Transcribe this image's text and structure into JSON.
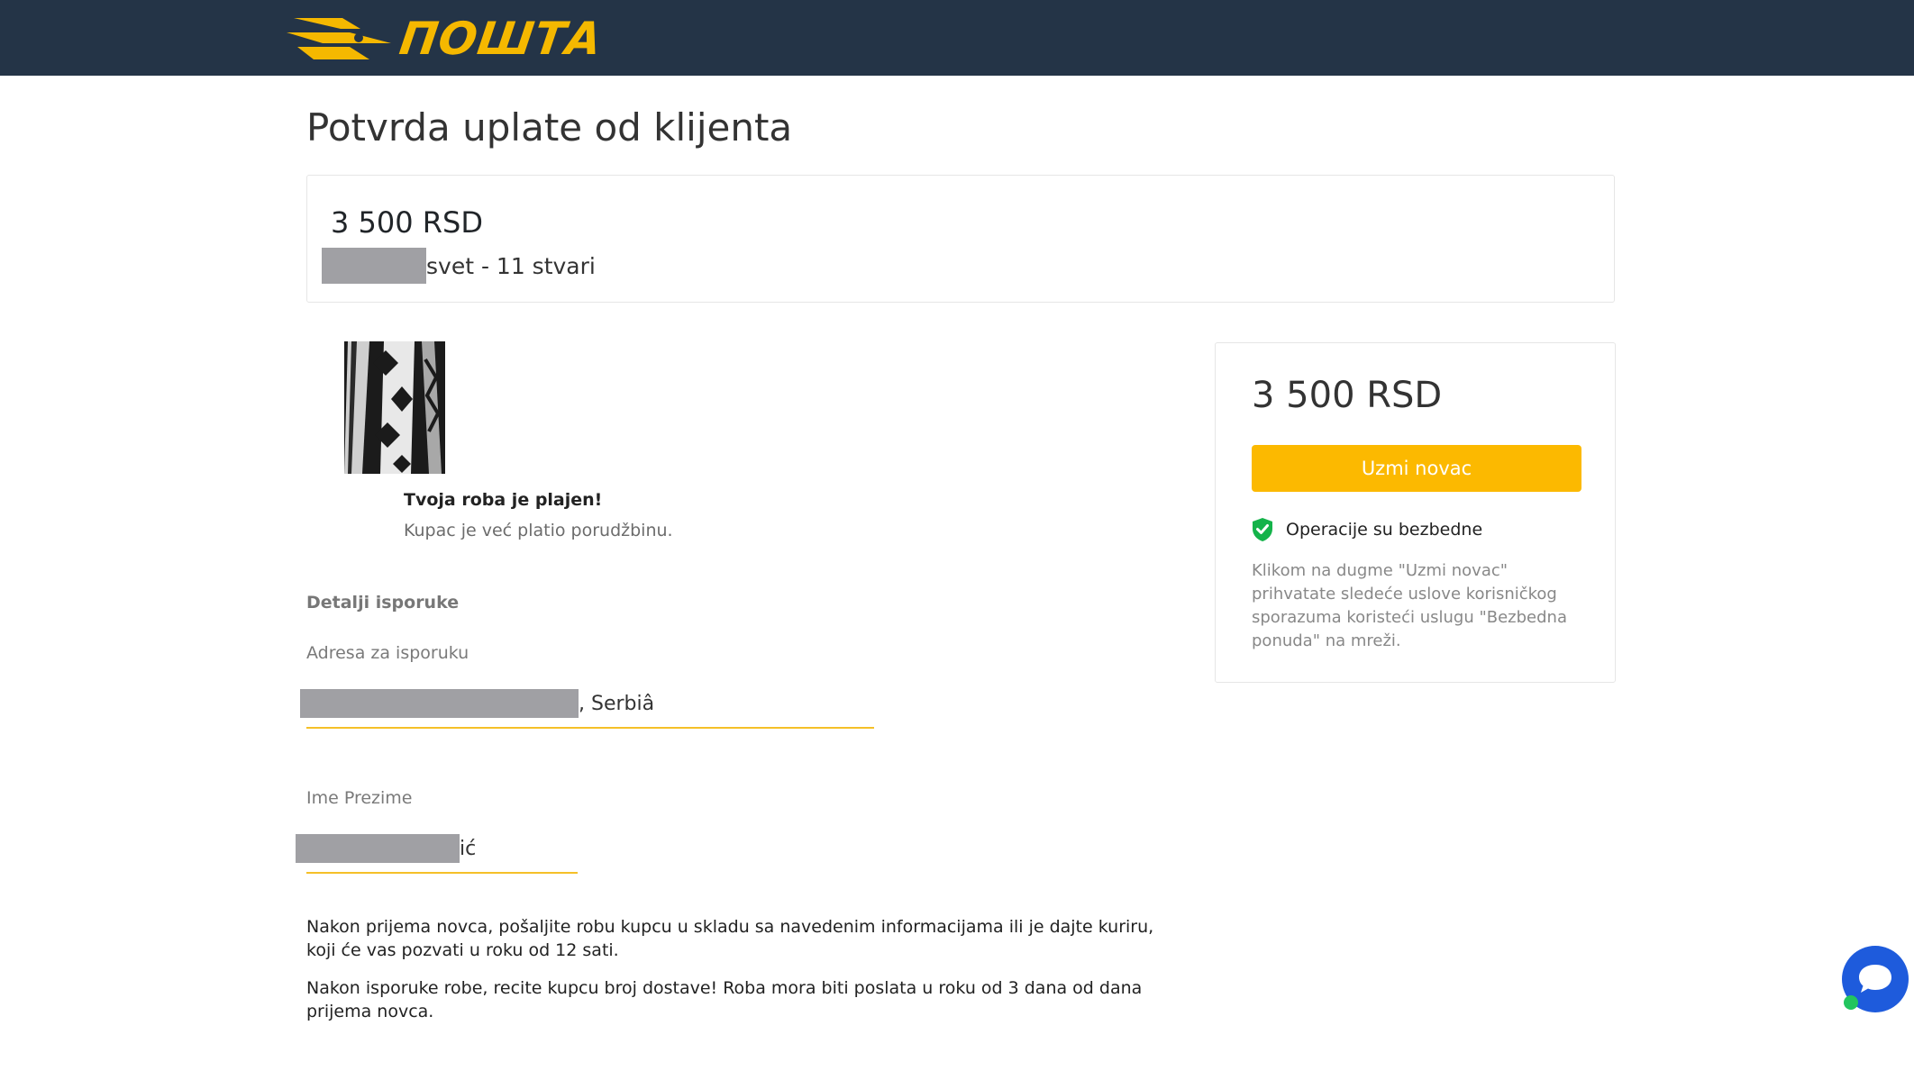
{
  "header": {
    "logo_text": "ПОШТА",
    "logo_icon": "post-horn-wings-icon"
  },
  "page": {
    "title": "Potvrda uplate od klijenta"
  },
  "order": {
    "amount": "3 500 RSD",
    "description_suffix": "svet - 11 stvari"
  },
  "product": {
    "image": "product-photo-black-white-pattern",
    "paid_title": "Tvoja roba je plajen!",
    "paid_subtitle": "Kupac je već platio porudžbinu."
  },
  "delivery": {
    "section_title": "Detalji isporuke",
    "address_label": "Adresa za isporuku",
    "address_suffix": ", Serbiâ",
    "name_label": "Ime Prezime",
    "name_suffix": "ić"
  },
  "info": {
    "paragraph_1": "Nakon prijema novca, pošaljite robu kupcu u skladu sa navedenim informacijama ili je dajte kuriru, koji će vas pozvati u roku od 12 sati.",
    "paragraph_2": "Nakon isporuke robe, recite kupcu broj dostave! Roba mora biti poslata u roku od 3 dana od dana prijema novca."
  },
  "payment": {
    "amount": "3 500 RSD",
    "button_label": "Uzmi novac",
    "secure_text": "Operacije su bezbedne",
    "terms_text": "Klikom na dugme \"Uzmi novac\" prihvatate sledeće uslove korisničkog sporazuma koristeći uslugu \"Bezbedna ponuda\" na mreži."
  },
  "chat": {
    "icon": "chat-bubble-icon",
    "status": "online"
  },
  "colors": {
    "header_bg": "#243447",
    "accent": "#fcb900",
    "logo": "#f5b800",
    "chat": "#1e5bdc",
    "shield": "#14b34a"
  }
}
